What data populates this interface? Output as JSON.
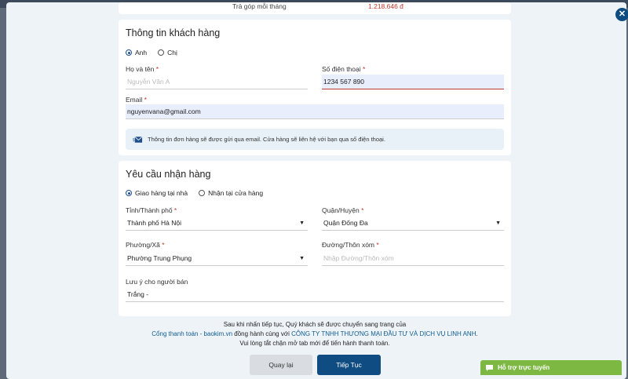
{
  "installment": {
    "label": "Trả góp mỗi tháng",
    "value": "1.218.646 đ"
  },
  "customer": {
    "title": "Thông tin khách hàng",
    "gender_options": [
      "Anh",
      "Chị"
    ],
    "gender_selected": "Anh",
    "name_label": "Họ và tên",
    "name_placeholder": "Nguyễn Văn A",
    "phone_label": "Số điện thoại",
    "phone_value": "1234 567 890",
    "email_label": "Email",
    "email_value": "nguyenvana@gmail.com",
    "notice": "Thông tin đơn hàng sẽ được gửi qua email. Cửa hàng sẽ liên hệ với bạn qua số điện thoại."
  },
  "delivery": {
    "title": "Yêu cầu nhận hàng",
    "method_options": [
      "Giao hàng tại nhà",
      "Nhận tại cửa hàng"
    ],
    "method_selected": "Giao hàng tại nhà",
    "province_label": "Tỉnh/Thành phố",
    "province_value": "Thành phố Hà Nội",
    "district_label": "Quận/Huyện",
    "district_value": "Quận Đống Đa",
    "ward_label": "Phường/Xã",
    "ward_value": "Phường Trung Phụng",
    "street_label": "Đường/Thôn xóm",
    "street_placeholder": "Nhập Đường/Thôn xóm",
    "note_label": "Lưu ý cho người bán",
    "note_value": "Trắng -"
  },
  "footer": {
    "line1": "Sau khi nhấn tiếp tục, Quý khách sẽ được chuyển sang trang của",
    "gateway_link": "Cổng thanh toán - baokim.vn",
    "middle": " đồng hành cùng với ",
    "company_link": "CÔNG TY TNHH THƯƠNG MẠI ĐẦU TƯ VÀ DỊCH VỤ LINH ANH",
    "period": ".",
    "line3": "Vui lòng tắt chặn mở tab mới để tiến hành thanh toán."
  },
  "buttons": {
    "back": "Quay lại",
    "next": "Tiếp Tục"
  },
  "support": {
    "label": "Hỗ trợ trực tuyến"
  },
  "close_symbol": "✕",
  "required_mark": "*",
  "caret_symbol": "▼",
  "colors": {
    "primary": "#0f4c81",
    "required": "#c0392b",
    "support": "#7cb842"
  }
}
